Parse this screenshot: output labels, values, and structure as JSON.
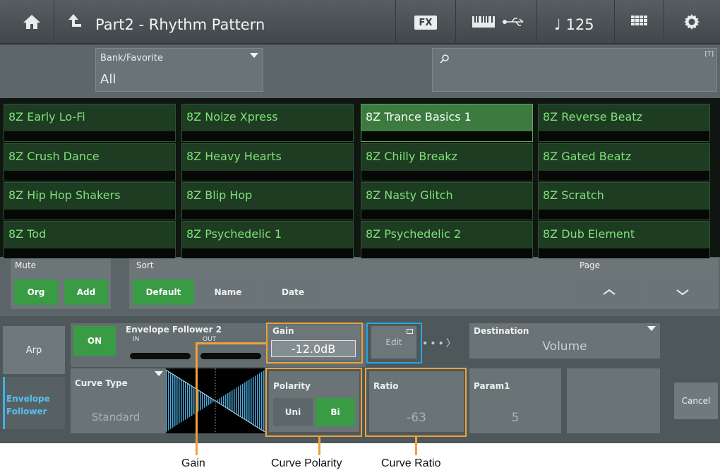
{
  "header": {
    "title": "Part2 - Rhythm Pattern",
    "fx_label": "FX",
    "tempo": "♩ 125"
  },
  "filter": {
    "bank_label": "Bank/Favorite",
    "bank_value": "All",
    "search_placeholder": "",
    "search_tag": "[T]"
  },
  "patterns": [
    "8Z Early Lo-Fi",
    "8Z Noize Xpress",
    "8Z Trance Basics 1",
    "8Z Reverse Beatz",
    "8Z Crush Dance",
    "8Z Heavy Hearts",
    "8Z Chilly Breakz",
    "8Z Gated Beatz",
    "8Z Hip Hop Shakers",
    "8Z Blip Hop",
    "8Z Nasty Glitch",
    "8Z Scratch",
    "8Z Tod",
    "8Z Psychedelic 1",
    "8Z Psychedelic 2",
    "8Z Dub Element"
  ],
  "selected_pattern": "8Z Trance Basics 1",
  "controls": {
    "mute_label": "Mute",
    "mute_org": "Org",
    "mute_add": "Add",
    "sort_label": "Sort",
    "sort_default": "Default",
    "sort_name": "Name",
    "sort_date": "Date",
    "page_label": "Page"
  },
  "envelope": {
    "arp_tab": "Arp",
    "env_tab_line1": "Envelope",
    "env_tab_line2": "Follower",
    "on_label": "ON",
    "title": "Envelope Follower 2",
    "in_label": "IN",
    "out_label": "OUT",
    "gain_label": "Gain",
    "gain_value": "-12.0dB",
    "edit_label": "Edit",
    "destination_label": "Destination",
    "destination_value": "Volume",
    "curve_type_label": "Curve Type",
    "curve_type_value": "Standard",
    "polarity_label": "Polarity",
    "polarity_uni": "Uni",
    "polarity_bi": "Bi",
    "ratio_label": "Ratio",
    "ratio_value": "-63",
    "param1_label": "Param1",
    "param1_value": "5",
    "cancel_label": "Cancel"
  },
  "annotations": {
    "gain": "Gain",
    "curve_polarity": "Curve Polarity",
    "curve_ratio": "Curve Ratio"
  },
  "colors": {
    "pattern_text": "#7fe07a",
    "selected_cell": "#3c7a40",
    "on_green": "#3a9b45",
    "callout_orange": "#f0a13c",
    "callout_blue": "#29a6e0"
  }
}
